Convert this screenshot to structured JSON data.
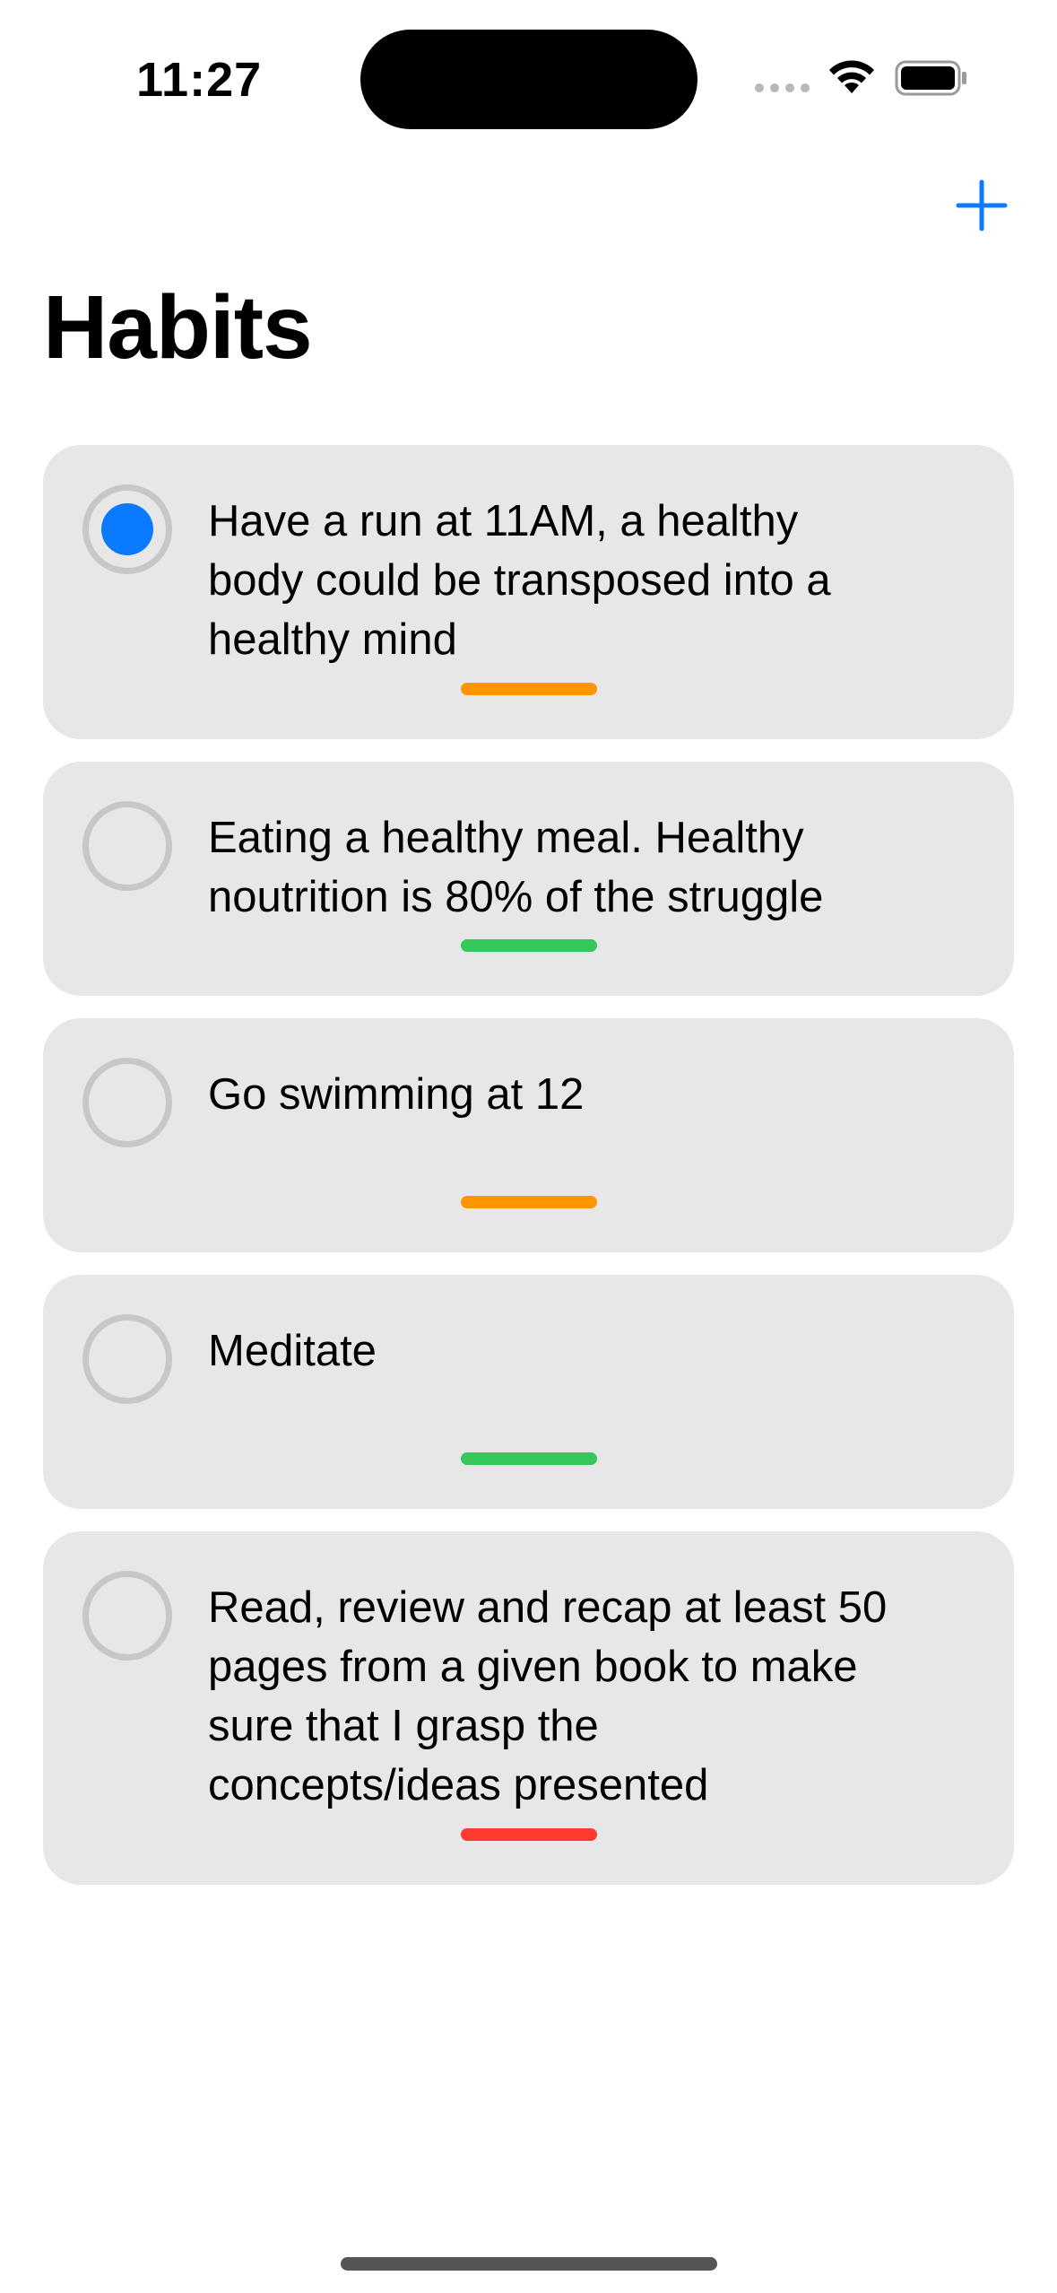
{
  "status_bar": {
    "time": "11:27"
  },
  "nav": {
    "add_icon": "plus-icon",
    "title": "Habits"
  },
  "colors": {
    "accent": "#0a7bff",
    "card_background": "#e7e7e7",
    "priority_orange": "#ff9500",
    "priority_green": "#34c759",
    "priority_red": "#ff3b30"
  },
  "habits": [
    {
      "text": "Have a run at 11AM, a healthy body could be transposed into a healthy mind",
      "completed": true,
      "priority_color": "#ff9500"
    },
    {
      "text": "Eating a healthy meal. Healthy noutrition is 80% of the struggle",
      "completed": false,
      "priority_color": "#34c759"
    },
    {
      "text": "Go swimming at 12",
      "completed": false,
      "priority_color": "#ff9500"
    },
    {
      "text": "Meditate",
      "completed": false,
      "priority_color": "#34c759"
    },
    {
      "text": "Read, review and recap at least 50 pages from a given book to make sure that I grasp the concepts/ideas presented",
      "completed": false,
      "priority_color": "#ff3b30"
    }
  ]
}
